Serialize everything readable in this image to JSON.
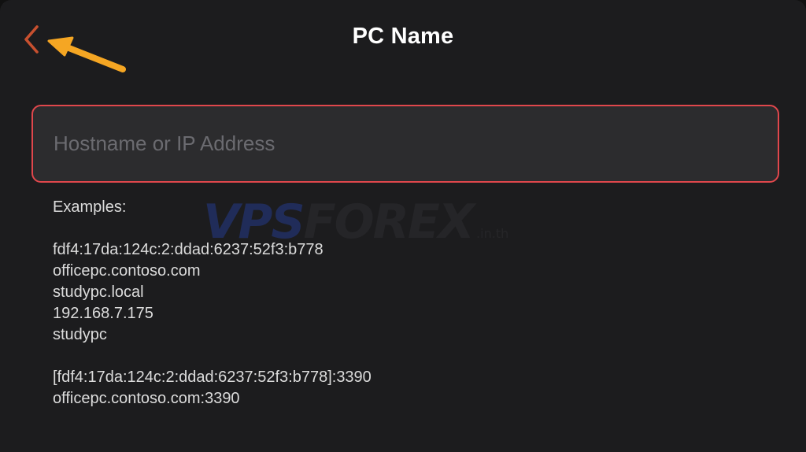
{
  "nav": {
    "title": "PC Name",
    "back_icon": "chevron-left-icon",
    "back_color": "#c8502f"
  },
  "annotation": {
    "arrow_icon": "arrow-annotation-icon",
    "color": "#f5a623"
  },
  "host_field": {
    "placeholder": "Hostname or IP Address",
    "value": "",
    "border_color": "#e0474c"
  },
  "watermark": {
    "part1": "VPS",
    "part2": "FOREX",
    "suffix": ".in.th"
  },
  "examples": {
    "heading": "Examples:",
    "group1": [
      "fdf4:17da:124c:2:ddad:6237:52f3:b778",
      "officepc.contoso.com",
      "studypc.local",
      "192.168.7.175",
      "studypc"
    ],
    "group2": [
      "[fdf4:17da:124c:2:ddad:6237:52f3:b778]:3390",
      "officepc.contoso.com:3390"
    ]
  }
}
